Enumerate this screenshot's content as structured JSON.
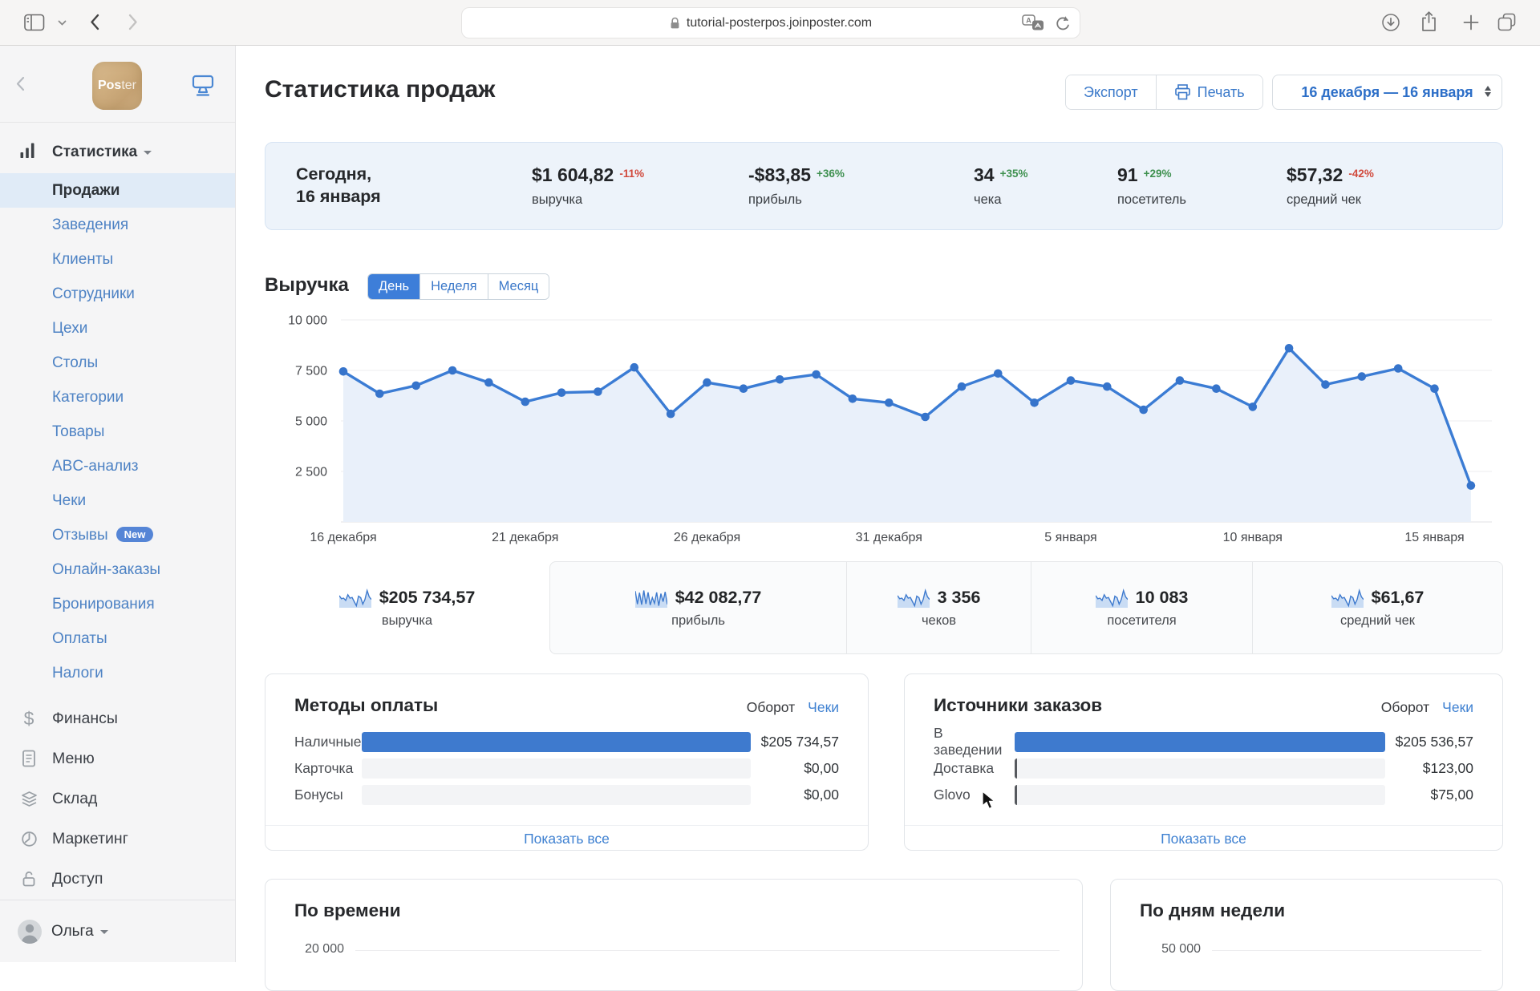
{
  "browser": {
    "url": "tutorial-posterpos.joinposter.com"
  },
  "sidebar": {
    "logo_text": "Poster",
    "statistics_label": "Статистика",
    "stat_items": [
      {
        "label": "Продажи",
        "active": true
      },
      {
        "label": "Заведения"
      },
      {
        "label": "Клиенты"
      },
      {
        "label": "Сотрудники"
      },
      {
        "label": "Цехи"
      },
      {
        "label": "Столы"
      },
      {
        "label": "Категории"
      },
      {
        "label": "Товары"
      },
      {
        "label": "ABC-анализ"
      },
      {
        "label": "Чеки"
      },
      {
        "label": "Отзывы",
        "badge": "New"
      },
      {
        "label": "Онлайн-заказы"
      },
      {
        "label": "Бронирования"
      },
      {
        "label": "Оплаты"
      },
      {
        "label": "Налоги"
      }
    ],
    "sections": [
      {
        "label": "Финансы"
      },
      {
        "label": "Меню"
      },
      {
        "label": "Склад"
      },
      {
        "label": "Маркетинг"
      },
      {
        "label": "Доступ"
      }
    ],
    "user": {
      "name": "Ольга"
    }
  },
  "header": {
    "title": "Статистика продаж",
    "export_label": "Экспорт",
    "print_label": "Печать",
    "date_range": "16 декабря — 16 января"
  },
  "today": {
    "title_line1": "Сегодня,",
    "title_line2": "16 января",
    "stats": [
      {
        "value": "$1 604,82",
        "delta": "-11%",
        "trend": "down",
        "label": "выручка"
      },
      {
        "value": "-$83,85",
        "delta": "+36%",
        "trend": "up",
        "label": "прибыль"
      },
      {
        "value": "34",
        "delta": "+35%",
        "trend": "up",
        "label": "чека"
      },
      {
        "value": "91",
        "delta": "+29%",
        "trend": "up",
        "label": "посетитель"
      },
      {
        "value": "$57,32",
        "delta": "-42%",
        "trend": "down",
        "label": "средний чек"
      }
    ]
  },
  "revenue": {
    "title": "Выручка",
    "tabs": [
      "День",
      "Неделя",
      "Месяц"
    ],
    "active_tab_index": 0
  },
  "chart_data": {
    "type": "area",
    "title": "Выручка",
    "period": "День",
    "ylim": [
      0,
      10000
    ],
    "yticks": [
      {
        "v": 2500,
        "label": "2 500"
      },
      {
        "v": 5000,
        "label": "5 000"
      },
      {
        "v": 7500,
        "label": "7 500"
      },
      {
        "v": 10000,
        "label": "10 000"
      }
    ],
    "x_tick_labels": [
      "16 декабря",
      "21 декабря",
      "26 декабря",
      "31 декабря",
      "5 января",
      "10 января",
      "15 января"
    ],
    "x_tick_indices": [
      0,
      5,
      10,
      15,
      20,
      25,
      30
    ],
    "values": [
      7450,
      6350,
      6750,
      7500,
      6900,
      5950,
      6400,
      6450,
      7650,
      5350,
      6900,
      6600,
      7050,
      7300,
      6100,
      5900,
      5200,
      6700,
      7350,
      5900,
      7000,
      6700,
      5550,
      7000,
      6600,
      5700,
      8600,
      6800,
      7200,
      7600,
      6600,
      1800
    ],
    "line_color": "#3b7cd4",
    "fill_color": "#e9f0fa",
    "grid": true,
    "legend": false
  },
  "totals": [
    {
      "value": "$205 734,57",
      "label": "выручка",
      "selected": true
    },
    {
      "value": "$42 082,77",
      "label": "прибыль"
    },
    {
      "value": "3 356",
      "label": "чеков"
    },
    {
      "value": "10 083",
      "label": "посетителя"
    },
    {
      "value": "$61,67",
      "label": "средний чек"
    }
  ],
  "payment_methods": {
    "title": "Методы оплаты",
    "turnover_label": "Оборот",
    "receipts_label": "Чеки",
    "rows": [
      {
        "label": "Наличные",
        "value": "$205 734,57",
        "pct": 100
      },
      {
        "label": "Карточка",
        "value": "$0,00",
        "pct": 0
      },
      {
        "label": "Бонусы",
        "value": "$0,00",
        "pct": 0
      }
    ],
    "footer_label": "Показать все"
  },
  "order_sources": {
    "title": "Источники заказов",
    "turnover_label": "Оборот",
    "receipts_label": "Чеки",
    "rows": [
      {
        "label": "В заведении",
        "value": "$205 536,57",
        "pct": 100
      },
      {
        "label": "Доставка",
        "value": "$123,00",
        "pct": 0.06
      },
      {
        "label": "Glovo",
        "value": "$75,00",
        "pct": 0.04
      }
    ],
    "footer_label": "Показать все"
  },
  "bottom_panels": [
    {
      "title": "По времени",
      "axis_label": "20 000"
    },
    {
      "title": "По дням недели",
      "axis_label": "50 000"
    }
  ],
  "colors": {
    "accent_blue": "#3d7ed9",
    "link_blue": "#4d82c4",
    "positive": "#3f9150",
    "negative": "#d14a3d"
  }
}
